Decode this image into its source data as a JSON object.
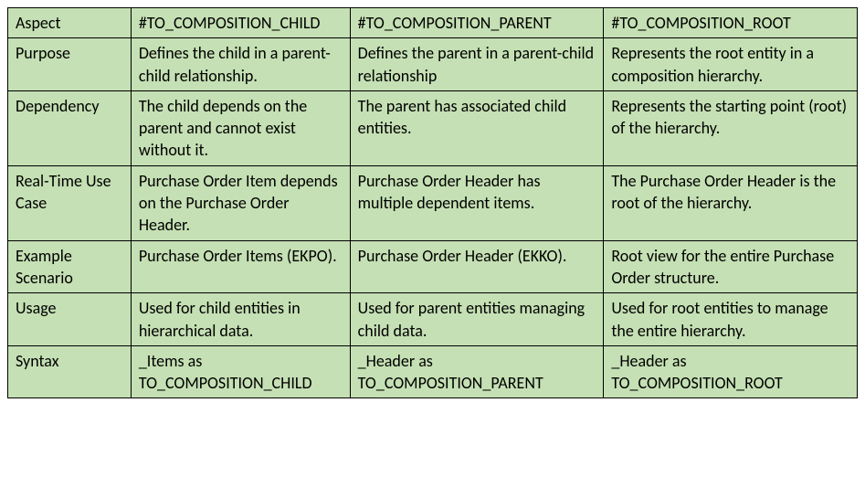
{
  "headers": [
    "Aspect",
    "#TO_COMPOSITION_CHILD",
    "#TO_COMPOSITION_PARENT",
    "#TO_COMPOSITION_ROOT"
  ],
  "rows": [
    {
      "aspect": "Purpose",
      "child": "Defines the child in a parent-child relationship.",
      "parent": "Defines the parent in a parent-child relationship",
      "root": "Represents the root entity in a composition hierarchy."
    },
    {
      "aspect": "Dependency",
      "child": "The child depends on the parent and cannot exist without it.",
      "parent": "The parent has associated child entities.",
      "root": "Represents the starting point (root) of the hierarchy."
    },
    {
      "aspect": "Real-Time Use Case",
      "child": "Purchase Order Item depends on the Purchase Order Header.",
      "parent": "Purchase Order Header has multiple dependent items.",
      "root": "The Purchase Order Header is the root of the hierarchy."
    },
    {
      "aspect": "Example Scenario",
      "child": "Purchase Order Items (EKPO).",
      "parent": "Purchase Order Header (EKKO).",
      "root": "Root view for the entire Purchase Order structure."
    },
    {
      "aspect": "Usage",
      "child": "Used for child entities in hierarchical data.",
      "parent": "Used for parent entities managing child data.",
      "root": "Used for root entities to manage the entire hierarchy."
    },
    {
      "aspect": "Syntax",
      "child": "_Items as TO_COMPOSITION_CHILD",
      "parent": "_Header as TO_COMPOSITION_PARENT",
      "root": "_Header as TO_COMPOSITION_ROOT"
    }
  ]
}
